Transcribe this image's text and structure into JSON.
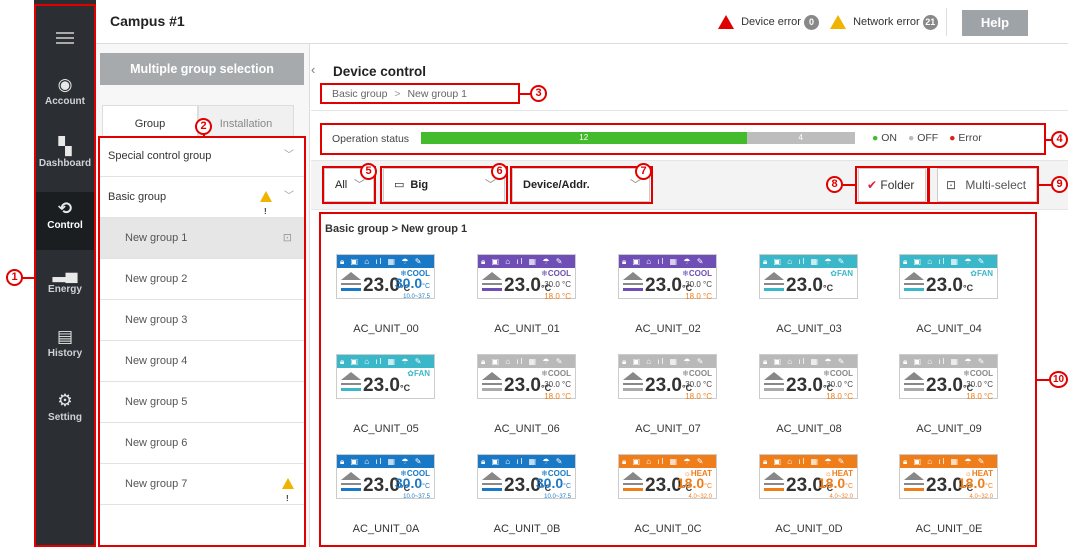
{
  "header": {
    "title": "Campus #1",
    "device_error_label": "Device error",
    "device_error_count": "0",
    "network_error_label": "Network error",
    "network_error_count": "21",
    "help_label": "Help"
  },
  "nav": [
    {
      "label": "Account"
    },
    {
      "label": "Dashboard"
    },
    {
      "label": "Control"
    },
    {
      "label": "Energy"
    },
    {
      "label": "History"
    },
    {
      "label": "Setting"
    }
  ],
  "left": {
    "multi_group_label": "Multiple group selection",
    "tab_group": "Group",
    "tab_installation": "Installation",
    "groups": [
      "Special control group",
      "Basic group",
      "New group 1",
      "New group 2",
      "New group 3",
      "New group 4",
      "New group 5",
      "New group 6",
      "New group 7"
    ]
  },
  "main": {
    "title": "Device control",
    "breadcrumb_1": "Basic group",
    "breadcrumb_sep": ">",
    "breadcrumb_2": "New group 1",
    "op_status_label": "Operation status",
    "op_on_count": "12",
    "op_off_count": "4",
    "on_fraction": 0.75,
    "legend_on": "ON",
    "legend_off": "OFF",
    "legend_error": "Error",
    "filter_all": "All",
    "filter_size": "Big",
    "filter_sort": "Device/Addr.",
    "folder_label": "Folder",
    "multiselect_label": "Multi-select",
    "path_label": "Basic group > New group 1"
  },
  "callouts": [
    "1",
    "2",
    "3",
    "4",
    "5",
    "6",
    "7",
    "8",
    "9",
    "10"
  ],
  "colors": {
    "cool": "#1a79c7",
    "purple": "#6f4eb5",
    "fan": "#3ab7c8",
    "off": "#b9b9b9",
    "heat": "#ef7d1a",
    "green": "#44bb2c"
  },
  "units": [
    {
      "name": "AC_UNIT_00",
      "color": "cool",
      "mode": "COOL",
      "temp": "23.0",
      "set": "30.0",
      "range": "10.0~37.5",
      "kind": "big"
    },
    {
      "name": "AC_UNIT_01",
      "color": "purple",
      "mode": "COOL",
      "temp": "23.0",
      "set": "30.0 °C",
      "set2": "18.0 °C",
      "kind": "dual"
    },
    {
      "name": "AC_UNIT_02",
      "color": "purple",
      "mode": "COOL",
      "temp": "23.0",
      "set": "30.0 °C",
      "set2": "18.0 °C",
      "kind": "dual"
    },
    {
      "name": "AC_UNIT_03",
      "color": "fan",
      "mode": "FAN",
      "temp": "23.0",
      "kind": "fan"
    },
    {
      "name": "AC_UNIT_04",
      "color": "fan",
      "mode": "FAN",
      "temp": "23.0",
      "kind": "fan"
    },
    {
      "name": "AC_UNIT_05",
      "color": "fan",
      "mode": "FAN",
      "temp": "23.0",
      "kind": "fan"
    },
    {
      "name": "AC_UNIT_06",
      "color": "off",
      "mode": "COOL",
      "temp": "23.0",
      "set": "30.0 °C",
      "set2": "18.0 °C",
      "kind": "dual"
    },
    {
      "name": "AC_UNIT_07",
      "color": "off",
      "mode": "COOL",
      "temp": "23.0",
      "set": "30.0 °C",
      "set2": "18.0 °C",
      "kind": "dual"
    },
    {
      "name": "AC_UNIT_08",
      "color": "off",
      "mode": "COOL",
      "temp": "23.0",
      "set": "30.0 °C",
      "set2": "18.0 °C",
      "kind": "dual"
    },
    {
      "name": "AC_UNIT_09",
      "color": "off",
      "mode": "COOL",
      "temp": "23.0",
      "set": "30.0 °C",
      "set2": "18.0 °C",
      "kind": "dual"
    },
    {
      "name": "AC_UNIT_0A",
      "color": "cool",
      "mode": "COOL",
      "temp": "23.0",
      "set": "30.0",
      "range": "10.0~37.5",
      "kind": "big"
    },
    {
      "name": "AC_UNIT_0B",
      "color": "cool",
      "mode": "COOL",
      "temp": "23.0",
      "set": "30.0",
      "range": "10.0~37.5",
      "kind": "big"
    },
    {
      "name": "AC_UNIT_0C",
      "color": "heat",
      "mode": "HEAT",
      "temp": "23.0",
      "set": "18.0",
      "range": "4.0~32.0",
      "kind": "heat"
    },
    {
      "name": "AC_UNIT_0D",
      "color": "heat",
      "mode": "HEAT",
      "temp": "23.0",
      "set": "18.0",
      "range": "4.0~32.0",
      "kind": "heat"
    },
    {
      "name": "AC_UNIT_0E",
      "color": "heat",
      "mode": "HEAT",
      "temp": "23.0",
      "set": "18.0",
      "range": "4.0~32.0",
      "kind": "heat"
    }
  ]
}
